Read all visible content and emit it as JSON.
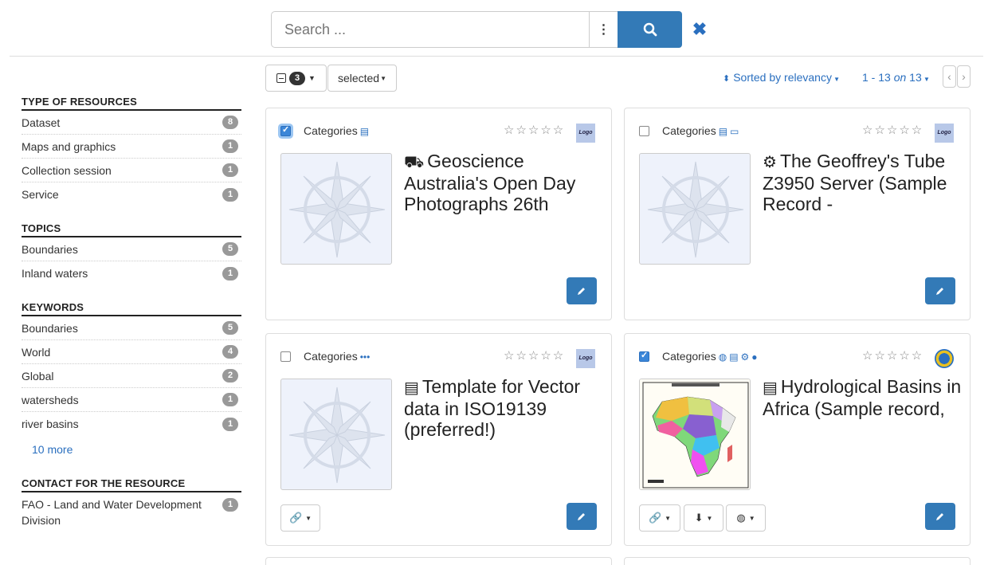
{
  "search": {
    "placeholder": "Search ...",
    "more_icon": "⋮"
  },
  "toolbar": {
    "selected_count": "3",
    "selected_label": "selected",
    "sort_label": "Sorted by relevancy",
    "pager_range": "1 - 13",
    "pager_on": "on",
    "pager_total": "13",
    "prev": "‹",
    "next": "›"
  },
  "facets": [
    {
      "title": "TYPE OF RESOURCES",
      "items": [
        {
          "label": "Dataset",
          "count": "8"
        },
        {
          "label": "Maps and graphics",
          "count": "1"
        },
        {
          "label": "Collection session",
          "count": "1"
        },
        {
          "label": "Service",
          "count": "1"
        }
      ]
    },
    {
      "title": "TOPICS",
      "items": [
        {
          "label": "Boundaries",
          "count": "5"
        },
        {
          "label": "Inland waters",
          "count": "1"
        }
      ]
    },
    {
      "title": "KEYWORDS",
      "items": [
        {
          "label": "Boundaries",
          "count": "5"
        },
        {
          "label": "World",
          "count": "4"
        },
        {
          "label": "Global",
          "count": "2"
        },
        {
          "label": "watersheds",
          "count": "1"
        },
        {
          "label": "river basins",
          "count": "1"
        }
      ],
      "more": "10 more"
    },
    {
      "title": "CONTACT FOR THE RESOURCE",
      "items": [
        {
          "label": "FAO - Land and Water Development Division",
          "count": "1"
        }
      ]
    }
  ],
  "cards": [
    {
      "checked": true,
      "category_label": "Categories",
      "category_icons": "🛢",
      "type_icon": "truck-icon",
      "title": "Geoscience Australia's Open Day Photographs 26th",
      "logo": "Logo"
    },
    {
      "checked": false,
      "category_label": "Categories",
      "category_icons": "🛢 🖥",
      "type_icon": "gear-icon",
      "title": "The Geoffrey's Tube Z3950 Server (Sample Record -",
      "logo": "Logo"
    },
    {
      "checked": false,
      "category_label": "Categories",
      "category_icons": "•••",
      "type_icon": "database-icon",
      "title": "Template for Vector data in ISO19139 (preferred!)",
      "logo": "Logo"
    },
    {
      "checked": true,
      "category_label": "Categories",
      "category_icons": "🌐 🛢 ⚙ 💧",
      "type_icon": "database-icon",
      "title": "Hydrological Basins in Africa (Sample record,",
      "logo": ""
    }
  ],
  "stars": "☆☆☆☆☆"
}
